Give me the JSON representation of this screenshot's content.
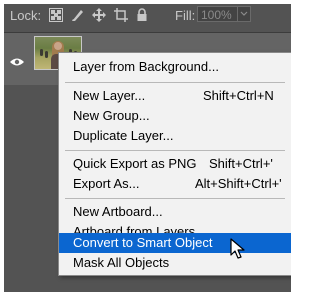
{
  "panel": {
    "lock_label": "Lock:",
    "lock_icons": [
      "lock-transparent-pixels-icon",
      "lock-image-pixels-icon",
      "lock-position-icon",
      "lock-artboard-icon",
      "lock-all-icon"
    ],
    "fill_label": "Fill:",
    "fill_value": "100%"
  },
  "layer": {
    "visibility_icon": "eye-icon",
    "thumbnail": "photo of a woman in a field"
  },
  "context_menu": {
    "items": [
      {
        "label": "Layer from Background...",
        "shortcut": ""
      },
      {
        "label": "New Layer...",
        "shortcut": "Shift+Ctrl+N"
      },
      {
        "label": "New Group...",
        "shortcut": ""
      },
      {
        "label": "Duplicate Layer...",
        "shortcut": ""
      },
      {
        "label": "Quick Export as PNG",
        "shortcut": "Shift+Ctrl+'"
      },
      {
        "label": "Export As...",
        "shortcut": "Alt+Shift+Ctrl+'"
      },
      {
        "label": "New Artboard...",
        "shortcut": ""
      },
      {
        "label": "Artboard from Layers...",
        "shortcut": ""
      },
      {
        "label": "Convert to Smart Object",
        "shortcut": "",
        "highlighted": true
      },
      {
        "label": "Mask All Objects",
        "shortcut": ""
      }
    ]
  },
  "colors": {
    "panel_bg": "#535353",
    "menu_bg": "#f2f2f2",
    "highlight": "#0b66d0"
  }
}
